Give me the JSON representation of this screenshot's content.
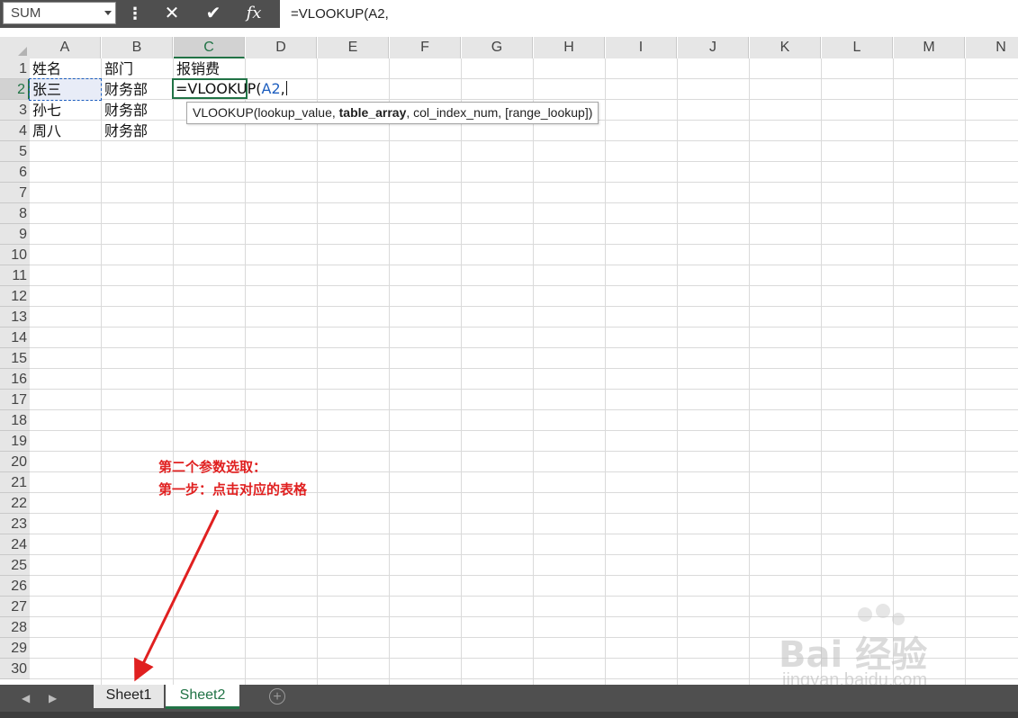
{
  "formula_bar": {
    "name_box": "SUM",
    "menu_icon": "more-vertical-icon",
    "cancel_icon": "✕",
    "enter_icon": "✔",
    "fx_label": "fx",
    "formula": "=VLOOKUP(A2,"
  },
  "columns": [
    "A",
    "B",
    "C",
    "D",
    "E",
    "F",
    "G",
    "H",
    "I",
    "J",
    "K",
    "L",
    "M",
    "N"
  ],
  "active_column": "C",
  "rows": [
    "1",
    "2",
    "3",
    "4",
    "5",
    "6",
    "7",
    "8",
    "9",
    "10",
    "11",
    "12",
    "13",
    "14",
    "15",
    "16",
    "17",
    "18",
    "19",
    "20",
    "21",
    "22",
    "23",
    "24",
    "25",
    "26",
    "27",
    "28",
    "29",
    "30"
  ],
  "active_row": "2",
  "cells": {
    "A1": "姓名",
    "B1": "部门",
    "C1": "报销费",
    "A2": "张三",
    "B2": "财务部",
    "A3": "孙七",
    "B3": "财务部",
    "A4": "周八",
    "B4": "财务部"
  },
  "editing_cell": {
    "prefix": "=VLOOKUP(",
    "ref": "A2",
    "suffix": ","
  },
  "tooltip": {
    "before": "VLOOKUP(lookup_value, ",
    "bold_arg": "table_array",
    "after": ", col_index_num, [range_lookup])"
  },
  "annotation": {
    "line1": "第二个参数选取：",
    "line2": "第一步：点击对应的表格",
    "color": "#e02020"
  },
  "sheet_tabs": {
    "tabs": [
      "Sheet1",
      "Sheet2"
    ],
    "active": "Sheet2",
    "add_icon": "⊕",
    "nav_prev": "◀",
    "nav_next": "▶"
  },
  "watermark": {
    "brand": "Bai 经验",
    "url": "jingyan.baidu.com"
  },
  "colors": {
    "accent": "#217346",
    "ref_blue": "#1f5fbf",
    "toolbar_bg": "#4f4f4f"
  }
}
